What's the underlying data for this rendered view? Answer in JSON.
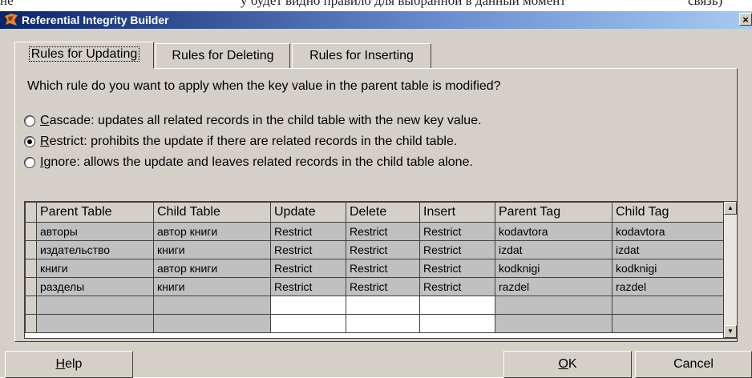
{
  "background_caption": {
    "left": "не",
    "middle": "у будет видно правило для выбранной в данный момент",
    "right": "связь)"
  },
  "window": {
    "title": "Referential Integrity Builder",
    "close_glyph": "×"
  },
  "tabs": [
    {
      "label": "Rules for Updating",
      "active": true
    },
    {
      "label": "Rules for Deleting",
      "active": false
    },
    {
      "label": "Rules for Inserting",
      "active": false
    }
  ],
  "question": "Which rule do you want to apply when the key value in the parent table is modified?",
  "options": [
    {
      "accel": "C",
      "text": "ascade: updates all related records in the child table with the new key value.",
      "checked": false
    },
    {
      "accel": "R",
      "text": "estrict: prohibits the update if there are related records in the child table.",
      "checked": true
    },
    {
      "accel": "I",
      "text": "gnore: allows the update and leaves related records in the child table alone.",
      "checked": false
    }
  ],
  "grid": {
    "columns": [
      "Parent Table",
      "Child Table",
      "Update",
      "Delete",
      "Insert",
      "Parent Tag",
      "Child Tag"
    ],
    "rows": [
      [
        "авторы",
        "автор книги",
        "Restrict",
        "Restrict",
        "Restrict",
        "kodavtora",
        "kodavtora"
      ],
      [
        "издательство",
        "книги",
        "Restrict",
        "Restrict",
        "Restrict",
        "izdat",
        "izdat"
      ],
      [
        "книги",
        "автор книги",
        "Restrict",
        "Restrict",
        "Restrict",
        "kodknigi",
        "kodknigi"
      ],
      [
        "разделы",
        "книги",
        "Restrict",
        "Restrict",
        "Restrict",
        "razdel",
        "razdel"
      ],
      [
        "",
        "",
        "",
        "",
        "",
        "",
        ""
      ],
      [
        "",
        "",
        "",
        "",
        "",
        "",
        ""
      ]
    ]
  },
  "buttons": {
    "help": {
      "accel": "H",
      "rest": "elp"
    },
    "ok": {
      "accel": "O",
      "rest": "K"
    },
    "cancel": "Cancel"
  }
}
